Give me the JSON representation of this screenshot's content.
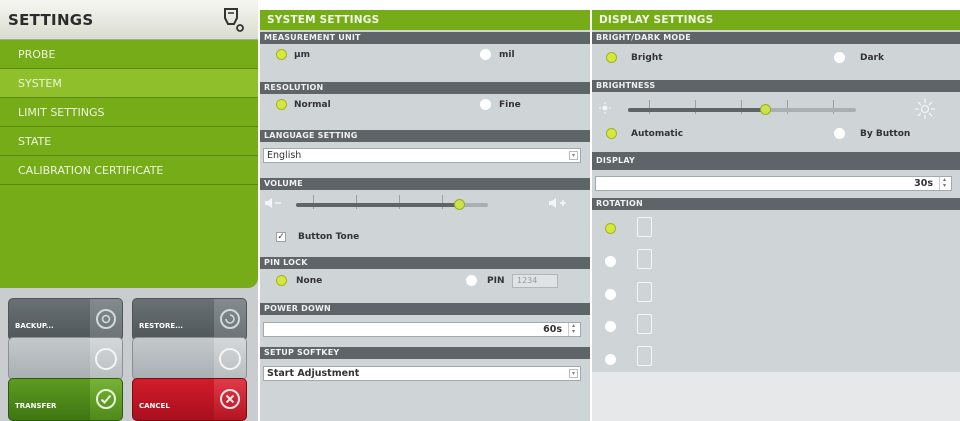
{
  "left": {
    "title": "SETTINGS",
    "nav": [
      "PROBE",
      "SYSTEM",
      "LIMIT SETTINGS",
      "STATE",
      "CALIBRATION CERTIFICATE"
    ],
    "active_index": 1,
    "buttons": {
      "backup": "BACKUP...",
      "restore": "RESTORE...",
      "transfer": "TRANSFER",
      "cancel": "CANCEL"
    }
  },
  "system": {
    "title": "SYSTEM SETTINGS",
    "measurement_unit": {
      "label": "MEASUREMENT UNIT",
      "options": [
        "µm",
        "mil"
      ],
      "selected": "µm"
    },
    "resolution": {
      "label": "RESOLUTION",
      "options": [
        "Normal",
        "Fine"
      ],
      "selected": "Normal"
    },
    "language": {
      "label": "LANGUAGE SETTING",
      "value": "English"
    },
    "volume": {
      "label": "VOLUME",
      "level": 0.85,
      "button_tone_label": "Button Tone",
      "button_tone_checked": true
    },
    "pin_lock": {
      "label": "PIN LOCK",
      "options": [
        "None",
        "PIN"
      ],
      "selected": "None",
      "pin_value": "1234"
    },
    "power_down": {
      "label": "POWER DOWN",
      "value": "60s"
    },
    "setup_softkey": {
      "label": "SETUP SOFTKEY",
      "value": "Start Adjustment"
    }
  },
  "display": {
    "title": "DISPLAY SETTINGS",
    "mode": {
      "label": "BRIGHT/DARK MODE",
      "options": [
        "Bright",
        "Dark"
      ],
      "selected": "Bright"
    },
    "brightness": {
      "label": "BRIGHTNESS",
      "level": 0.6,
      "options": [
        "Automatic",
        "By Button"
      ],
      "selected": "Automatic"
    },
    "display": {
      "label": "DISPLAY",
      "value": "30s"
    },
    "rotation": {
      "label": "ROTATION",
      "count": 5,
      "selected_index": 0
    }
  },
  "colors": {
    "accent_green": "#76ac17",
    "header_grey": "#5e6468",
    "cancel_red": "#c8182a"
  }
}
